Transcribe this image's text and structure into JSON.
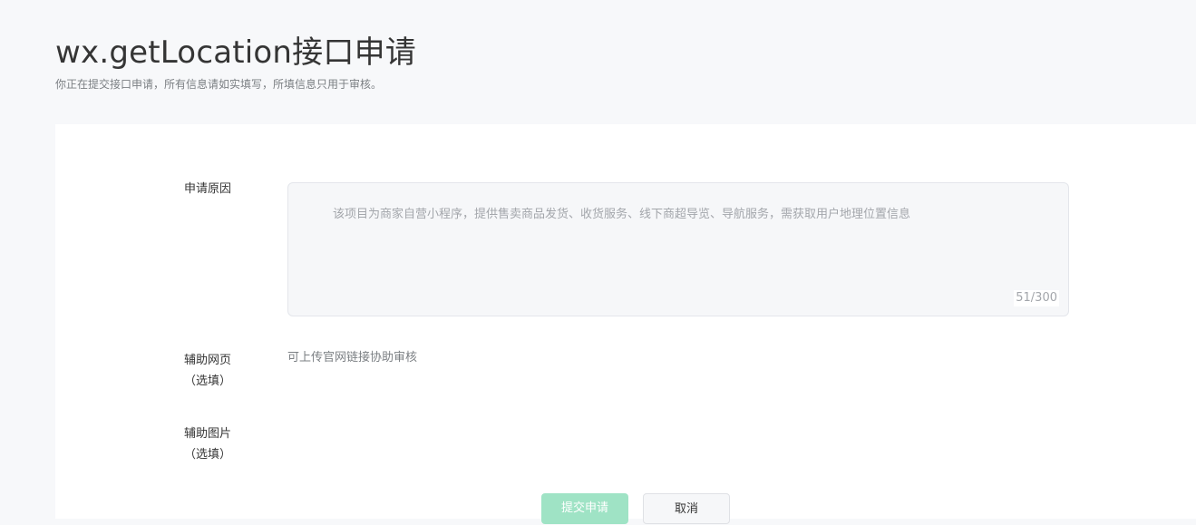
{
  "header": {
    "title": "wx.getLocation接口申请",
    "description": "你正在提交接口申请，所有信息请如实填写，所填信息只用于审核。"
  },
  "form": {
    "reason": {
      "label": "申请原因",
      "value": "该项目为商家自营小程序，提供售卖商品发货、收货服务、线下商超导览、导航服务，需获取用户地理位置信息",
      "counter": "51/300"
    },
    "webpage": {
      "label_line1": "辅助网页",
      "label_line2": "（选填）",
      "hint": "可上传官网链接协助审核"
    },
    "image": {
      "label_line1": "辅助图片",
      "label_line2": "（选填）"
    }
  },
  "actions": {
    "submit_label": "提交申请",
    "cancel_label": "取消",
    "submit_color": "#9fe3c5"
  }
}
